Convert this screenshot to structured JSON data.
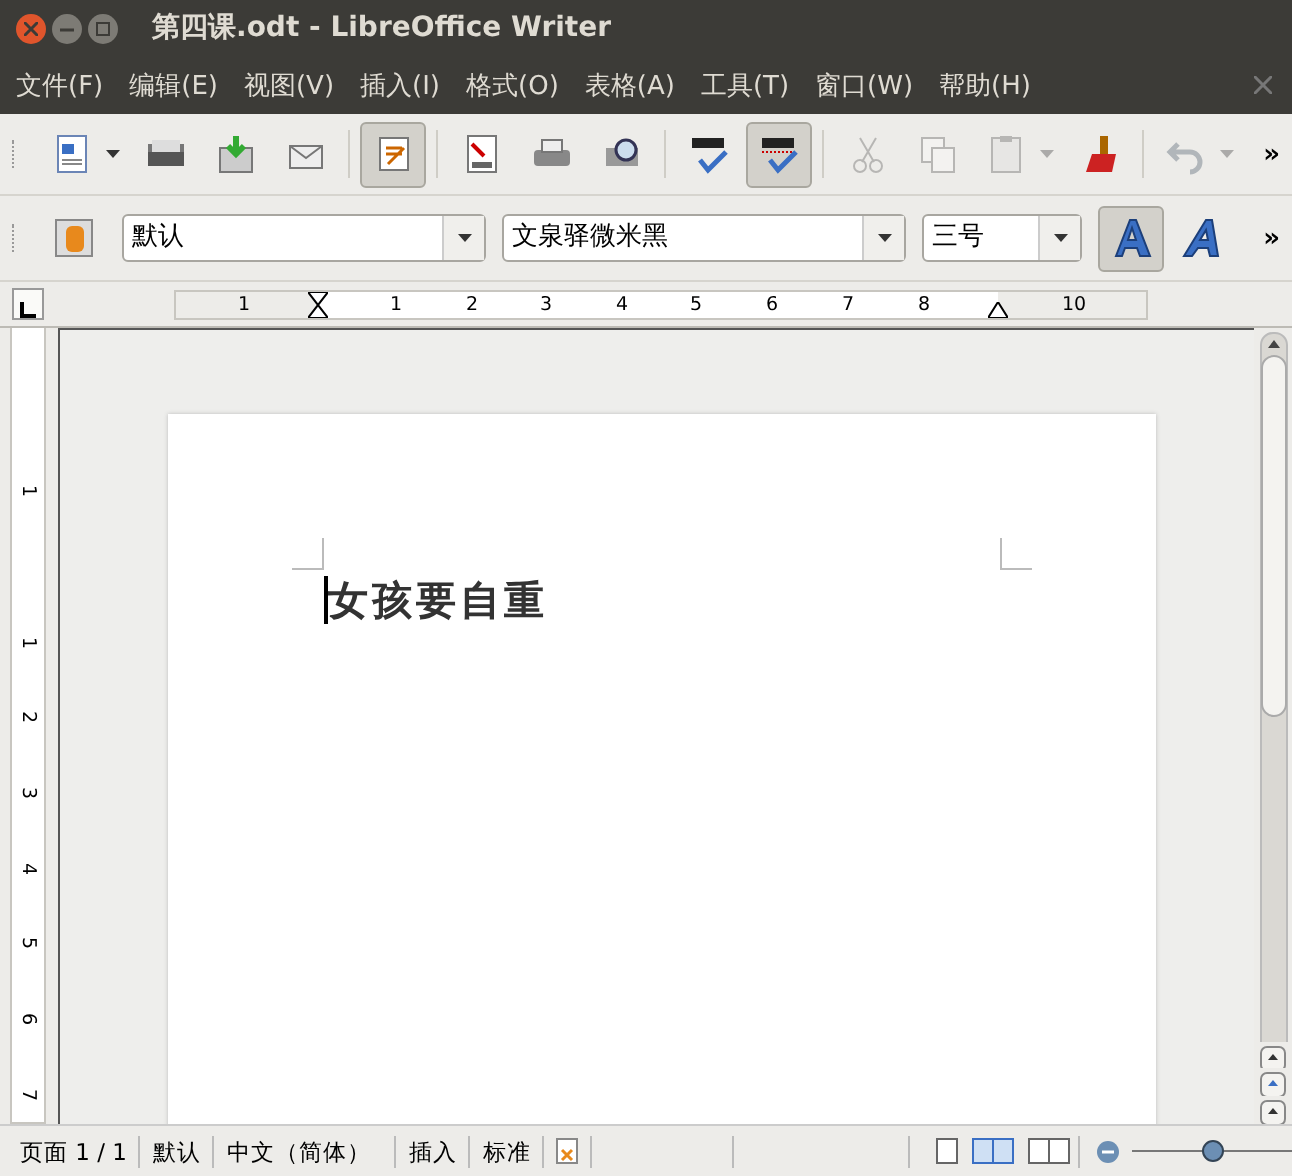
{
  "window": {
    "title": "第四课.odt - LibreOffice Writer"
  },
  "menu": [
    "文件(F)",
    "编辑(E)",
    "视图(V)",
    "插入(I)",
    "格式(O)",
    "表格(A)",
    "工具(T)",
    "窗口(W)",
    "帮助(H)"
  ],
  "toolbar": {
    "buttons": [
      {
        "selected": false,
        "disabled": false,
        "dropdown": true
      },
      {
        "selected": false,
        "disabled": false,
        "dropdown": false
      },
      {
        "selected": false,
        "disabled": false,
        "dropdown": false
      },
      {
        "selected": false,
        "disabled": false,
        "dropdown": false
      },
      {
        "selected": true,
        "disabled": false,
        "dropdown": false
      },
      {
        "selected": false,
        "disabled": false,
        "dropdown": false
      },
      {
        "selected": false,
        "disabled": false,
        "dropdown": false
      },
      {
        "selected": false,
        "disabled": false,
        "dropdown": false
      },
      {
        "selected": false,
        "disabled": false,
        "dropdown": false
      },
      {
        "selected": true,
        "disabled": false,
        "dropdown": false
      },
      {
        "selected": false,
        "disabled": true,
        "dropdown": false
      },
      {
        "selected": false,
        "disabled": true,
        "dropdown": false
      },
      {
        "selected": false,
        "disabled": true,
        "dropdown": true
      },
      {
        "selected": false,
        "disabled": false,
        "dropdown": false
      },
      {
        "selected": false,
        "disabled": true,
        "dropdown": true
      }
    ],
    "overflow": "»"
  },
  "format_bar": {
    "style": "默认",
    "font": "文泉驿微米黑",
    "size": "三号",
    "bold_selected": true,
    "italic_selected": false,
    "overflow": "»"
  },
  "horizontal_ruler": {
    "labels": [
      "1",
      "1",
      "2",
      "3",
      "4",
      "5",
      "6",
      "7",
      "8",
      "10"
    ]
  },
  "vertical_ruler": {
    "labels": [
      "1",
      "1",
      "2",
      "3",
      "4",
      "5",
      "6",
      "7"
    ]
  },
  "document": {
    "text": "女孩要自重"
  },
  "status_bar": {
    "page": "页面 1 / 1",
    "style": "默认",
    "language": "中文（简体）",
    "mode": "插入",
    "selection": "标准",
    "views": [
      {
        "selected": false
      },
      {
        "selected": true
      },
      {
        "selected": false
      }
    ],
    "zoom": {
      "level": 0.5
    }
  }
}
